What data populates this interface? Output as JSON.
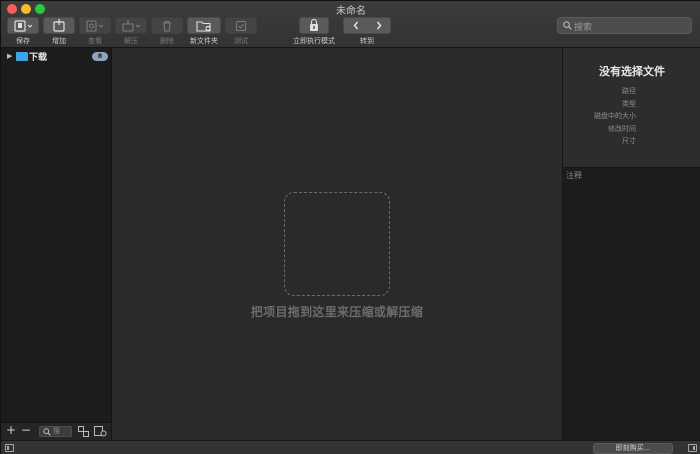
{
  "window": {
    "title": "未命名"
  },
  "toolbar": {
    "save_label": "保存",
    "add_label": "增加",
    "view_label": "查看",
    "extract_label": "解压",
    "delete_label": "删除",
    "new_folder_label": "新文件夹",
    "test_label": "测试",
    "instant_mode_label": "立即执行模式",
    "goto_label": "转到"
  },
  "search": {
    "placeholder": "搜索"
  },
  "sidebar": {
    "items": [
      {
        "label": "下载",
        "count": "8",
        "icon": "folder-icon"
      }
    ],
    "filter_placeholder": "搜"
  },
  "main": {
    "drop_hint": "把项目拖到这里来压缩或解压缩"
  },
  "inspector": {
    "title": "没有选择文件",
    "fields": [
      "路径",
      "类型",
      "磁盘中的大小",
      "修改时间",
      "尺寸"
    ],
    "notes_label": "注释"
  },
  "statusbar": {
    "buy_label": "即刻购买..."
  },
  "colors": {
    "accent_folder": "#3ea6e5",
    "badge": "#8ea3bc"
  }
}
